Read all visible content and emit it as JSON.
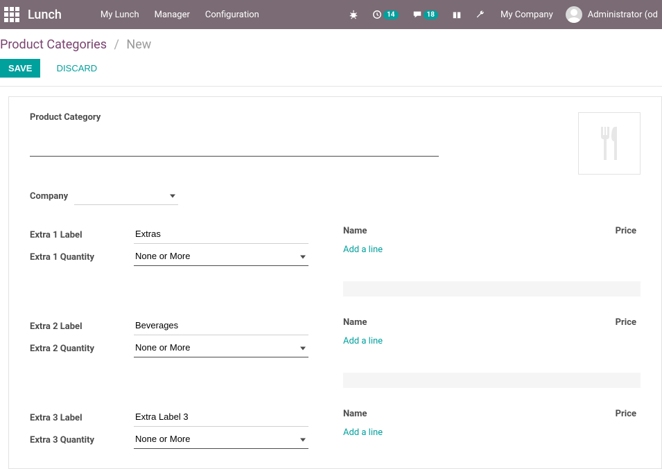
{
  "nav": {
    "brand": "Lunch",
    "links": [
      "My Lunch",
      "Manager",
      "Configuration"
    ],
    "badge_clock": "14",
    "badge_chat": "18",
    "company": "My Company",
    "user": "Administrator (od"
  },
  "breadcrumb": {
    "parent": "Product Categories",
    "sep": "/",
    "current": "New"
  },
  "buttons": {
    "save": "SAVE",
    "discard": "DISCARD"
  },
  "form": {
    "category_label": "Product Category",
    "category_value": "",
    "company_label": "Company",
    "company_value": ""
  },
  "extras": [
    {
      "label_caption": "Extra 1 Label",
      "label_value": "Extras",
      "qty_caption": "Extra 1 Quantity",
      "qty_value": "None or More"
    },
    {
      "label_caption": "Extra 2 Label",
      "label_value": "Beverages",
      "qty_caption": "Extra 2 Quantity",
      "qty_value": "None or More"
    },
    {
      "label_caption": "Extra 3 Label",
      "label_value": "Extra Label 3",
      "qty_caption": "Extra 3 Quantity",
      "qty_value": "None or More"
    }
  ],
  "table": {
    "col_name": "Name",
    "col_price": "Price",
    "add_line": "Add a line"
  }
}
